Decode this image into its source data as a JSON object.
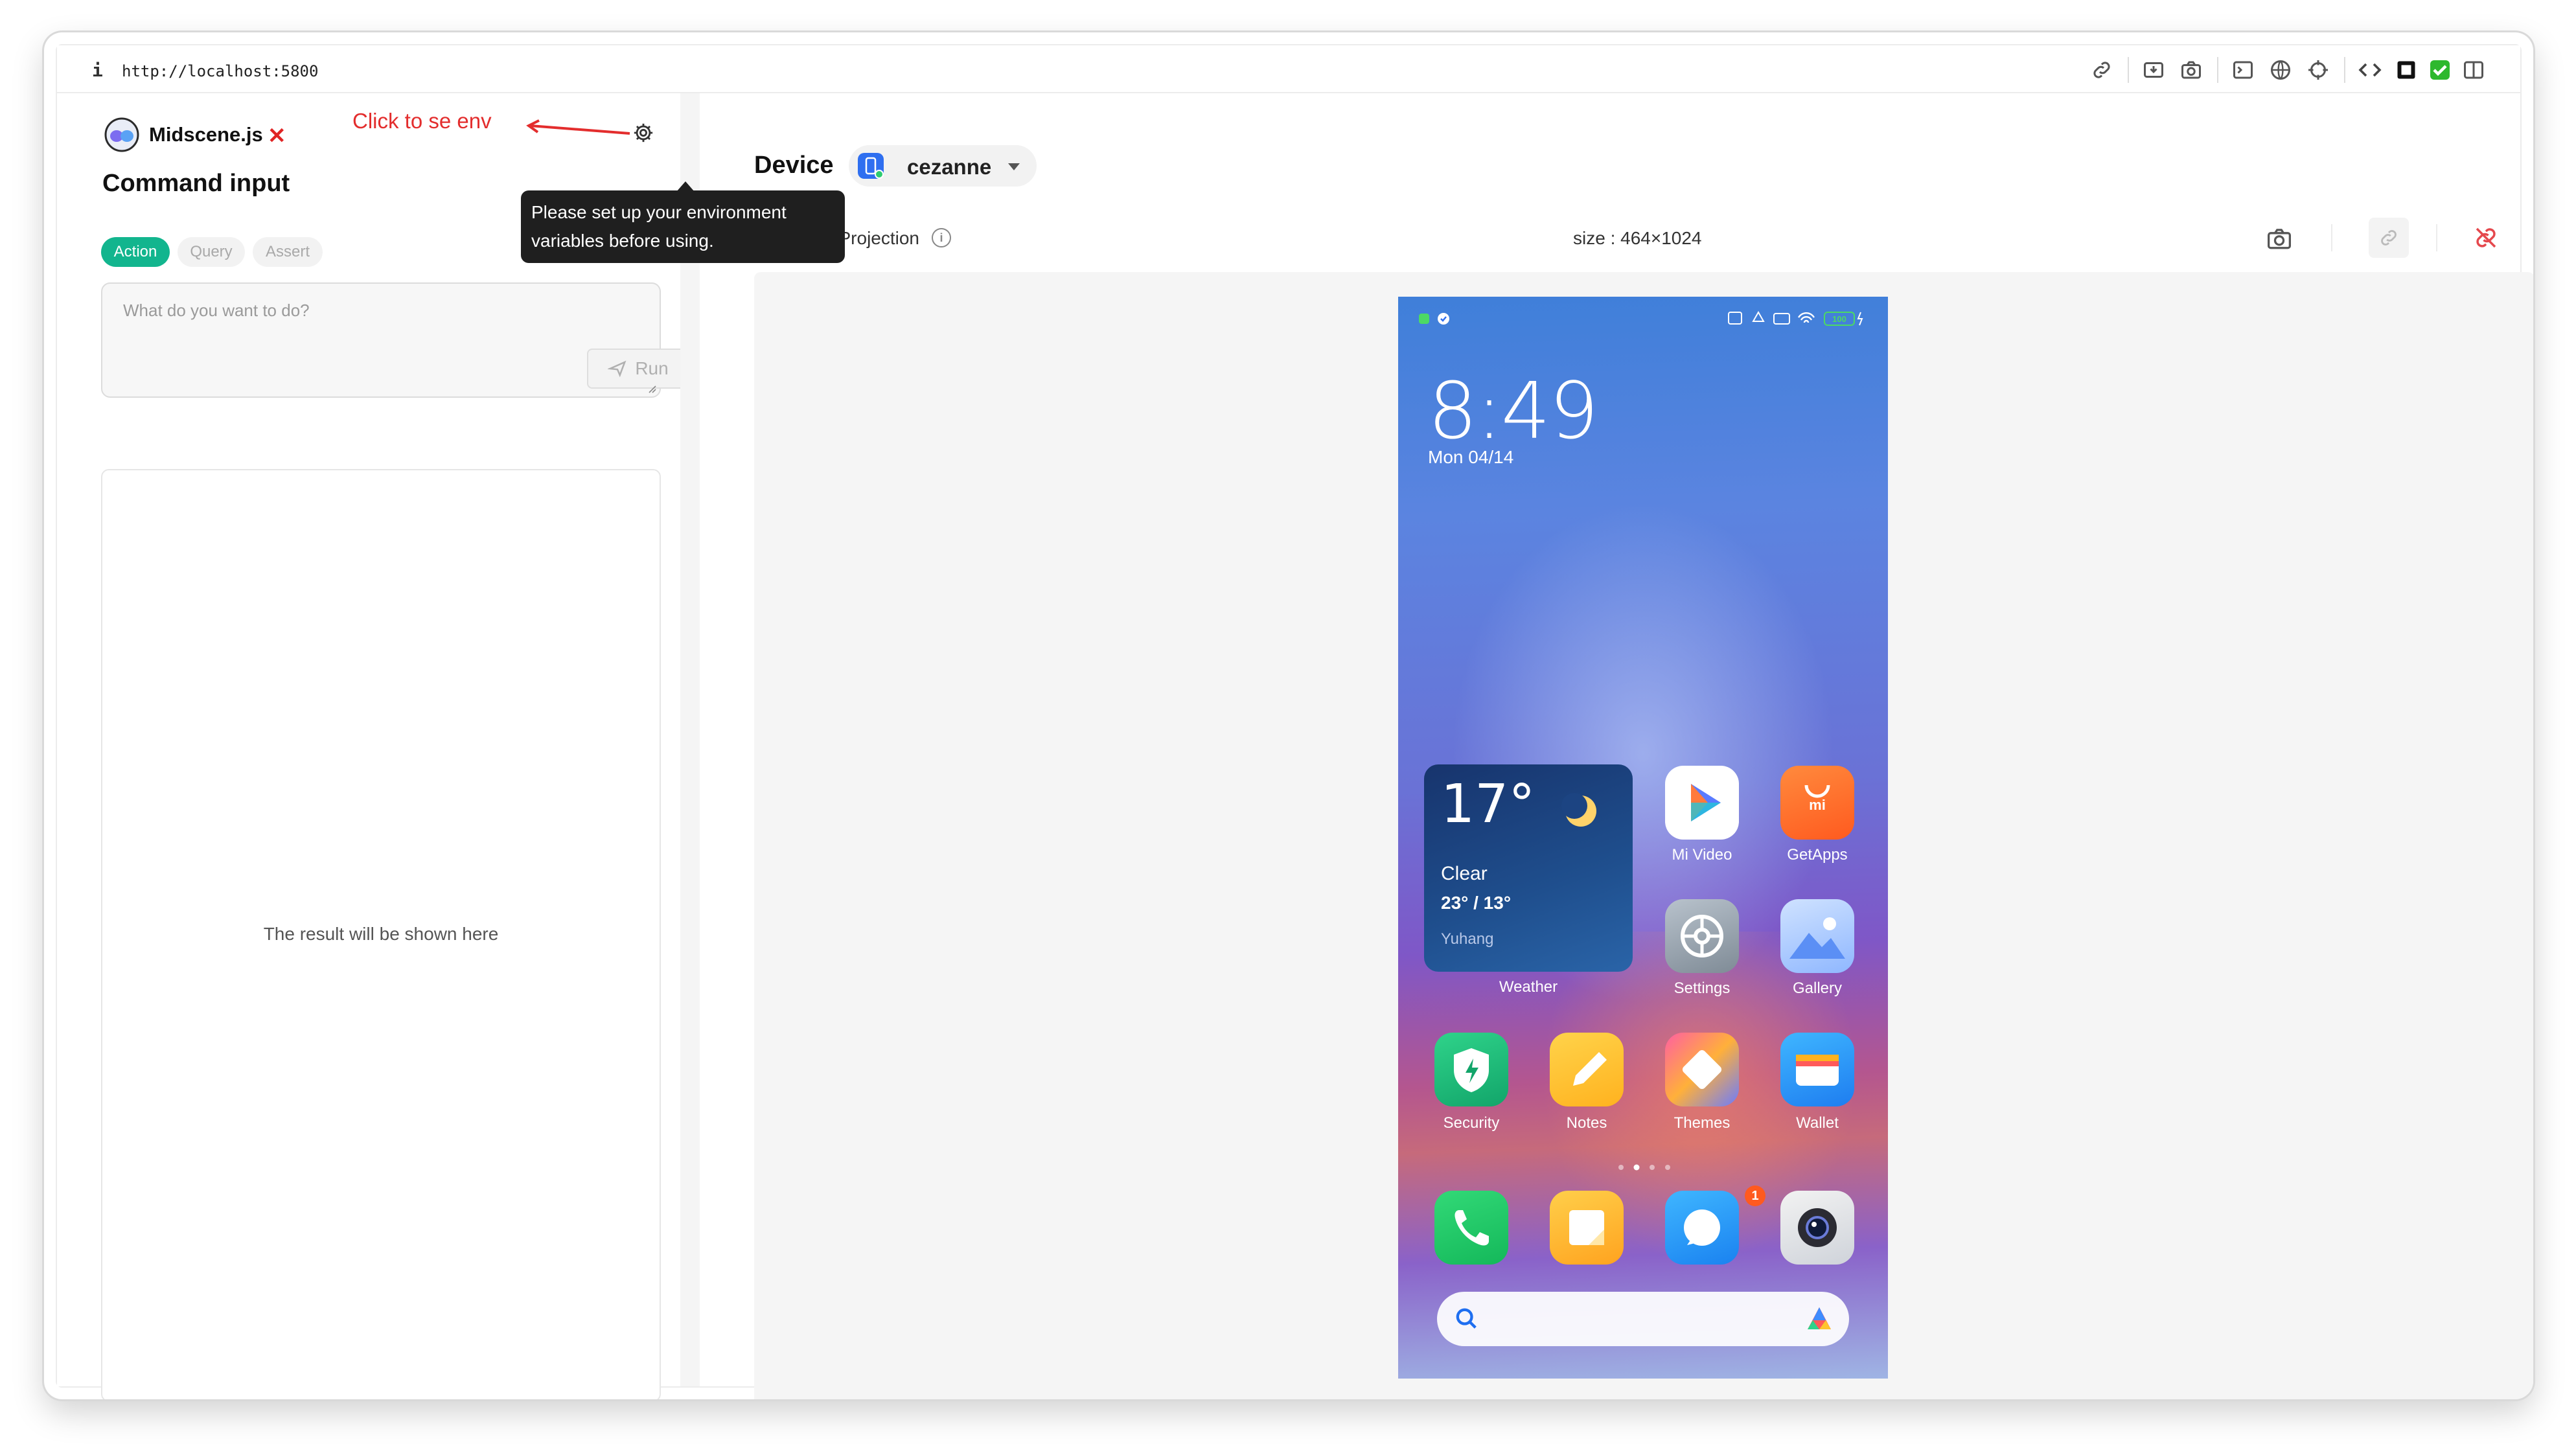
{
  "browser": {
    "info_glyph": "i",
    "url": "http://localhost:5800"
  },
  "left_panel": {
    "brand": "Midscene.js",
    "close_glyph": "✕",
    "annotation": "Click to se env",
    "title": "Command input",
    "tabs": [
      {
        "label": "Action",
        "active": true
      },
      {
        "label": "Query",
        "active": false
      },
      {
        "label": "Assert",
        "active": false
      }
    ],
    "prompt_placeholder": "What do you want to do?",
    "run_label": "Run",
    "result_placeholder": "The result will be shown here",
    "tooltip_line1": "Please set up your environment",
    "tooltip_line2": "variables before using."
  },
  "device_panel": {
    "title": "Device",
    "device_name": "cezanne",
    "projection_label": "Screen Projection",
    "size_label": "size : 464×1024"
  },
  "phone": {
    "time": "8:49",
    "date": "Mon 04/14",
    "weather": {
      "temp": "17°",
      "condition": "Clear",
      "range": "23° / 13°",
      "city": "Yuhang",
      "label": "Weather"
    },
    "apps_row1": [
      {
        "label": "Mi Video",
        "icon": "mi-video-icon"
      },
      {
        "label": "GetApps",
        "icon": "getapps-icon"
      }
    ],
    "apps_row2": [
      {
        "label": "Settings",
        "icon": "settings-icon"
      },
      {
        "label": "Gallery",
        "icon": "gallery-icon"
      }
    ],
    "apps_row3": [
      {
        "label": "Security",
        "icon": "security-icon"
      },
      {
        "label": "Notes",
        "icon": "notes-icon"
      },
      {
        "label": "Themes",
        "icon": "themes-icon"
      },
      {
        "label": "Wallet",
        "icon": "wallet-icon"
      }
    ],
    "dock": [
      "phone-icon",
      "notes-dock-icon",
      "messages-icon",
      "camera-icon"
    ],
    "messages_badge": "1",
    "battery": "100"
  },
  "colors": {
    "accent": "#12b58e",
    "annotation": "#e32d2d",
    "tooltip_bg": "#1f1f1f",
    "disconnect": "#e5484d"
  }
}
